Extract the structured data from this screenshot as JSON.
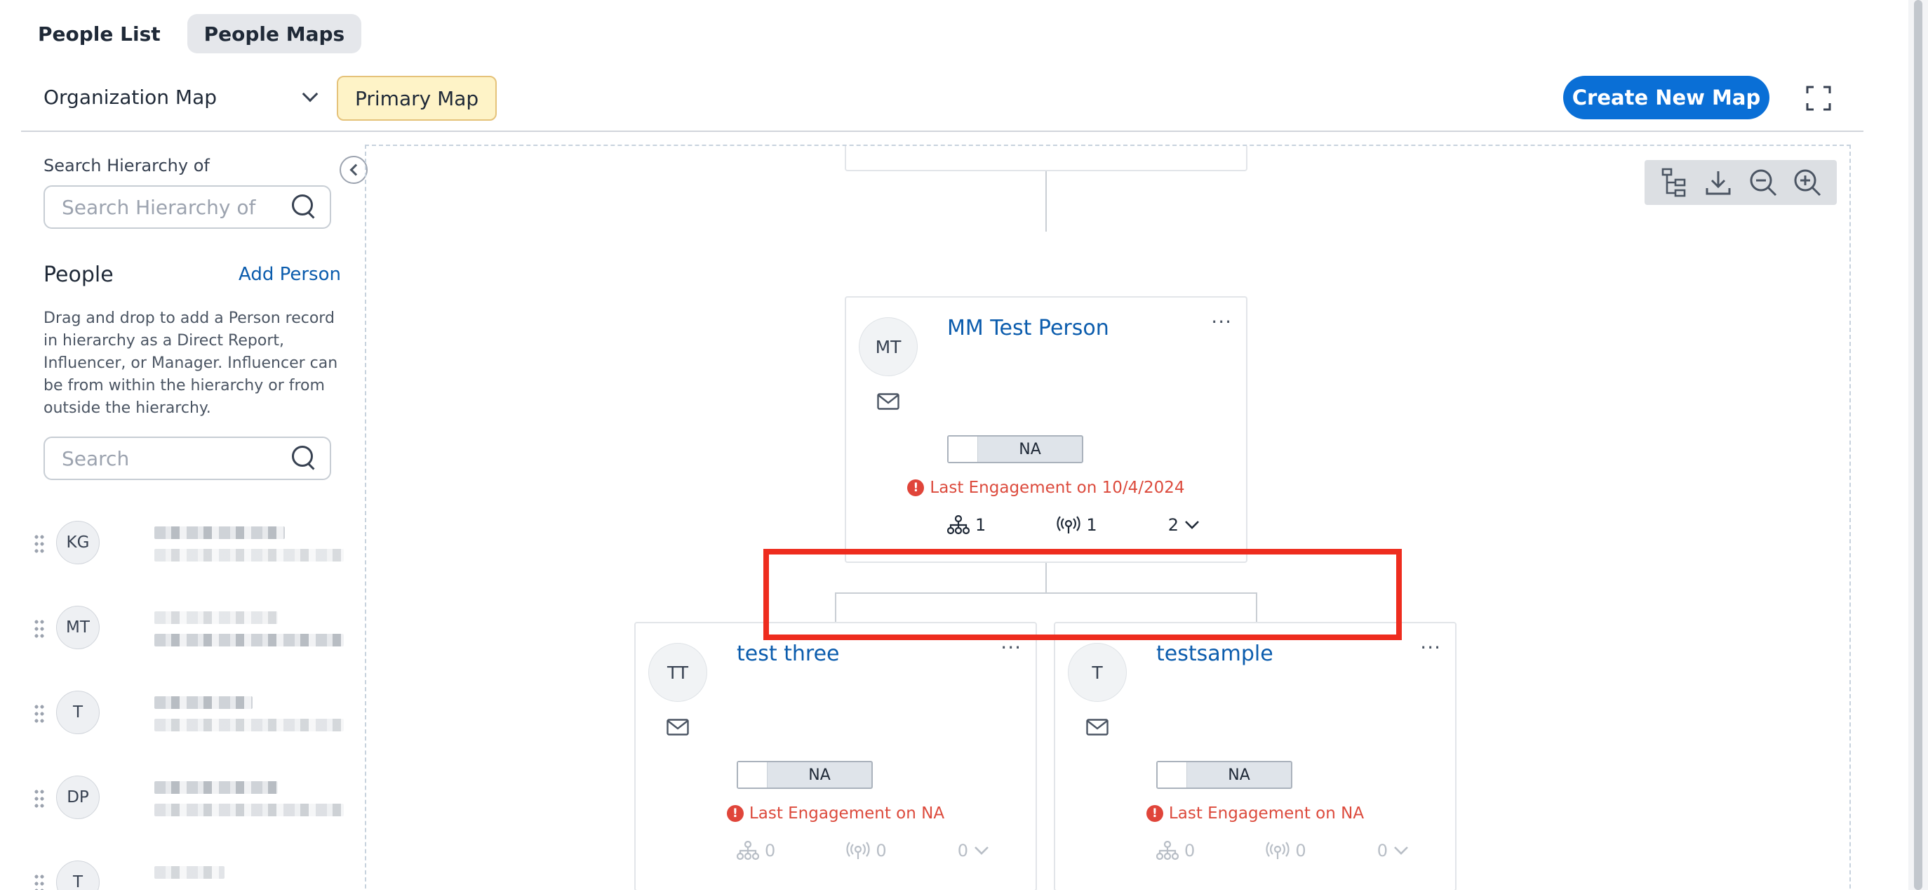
{
  "tabs": [
    {
      "label": "People List",
      "active": false
    },
    {
      "label": "People Maps",
      "active": true
    }
  ],
  "map_select": {
    "value": "Organization Map"
  },
  "primary_badge": "Primary Map",
  "create_button": "Create New Map",
  "sidebar": {
    "search_hierarchy_label": "Search Hierarchy of",
    "search_hierarchy_placeholder": "Search Hierarchy of",
    "people_heading": "People",
    "add_person": "Add Person",
    "help_text": "Drag and drop to add a Person record in hierarchy as a Direct Report, Influencer, or Manager. Influencer can be from within the hierarchy or from outside the hierarchy.",
    "search_placeholder": "Search",
    "people": [
      {
        "initials": "KG"
      },
      {
        "initials": "MT"
      },
      {
        "initials": "T"
      },
      {
        "initials": "DP"
      },
      {
        "initials": "T"
      }
    ]
  },
  "cards": {
    "root": {
      "initials": "MT",
      "name": "MM Test Person",
      "status": "NA",
      "engagement": "Last Engagement on 10/4/2024",
      "reports": "1",
      "influencers": "1",
      "expand": "2"
    },
    "child1": {
      "initials": "TT",
      "name": "test three",
      "status": "NA",
      "engagement": "Last Engagement on NA",
      "reports": "0",
      "influencers": "0",
      "expand": "0"
    },
    "child2": {
      "initials": "T",
      "name": "testsample",
      "status": "NA",
      "engagement": "Last Engagement on NA",
      "reports": "0",
      "influencers": "0",
      "expand": "0"
    }
  },
  "more_dots": "···",
  "colors": {
    "accent": "#0a6fd6",
    "link": "#0b5cad",
    "warning": "#dc4a3c",
    "highlight": "#ee2c1e",
    "badge": "#fef3c7"
  },
  "icons": [
    "search-icon",
    "chevron-down-icon",
    "fullscreen-icon",
    "hierarchy-icon",
    "download-icon",
    "zoom-out-icon",
    "zoom-in-icon",
    "mail-icon",
    "org-chart-icon",
    "influencer-icon",
    "drag-handle-icon"
  ]
}
